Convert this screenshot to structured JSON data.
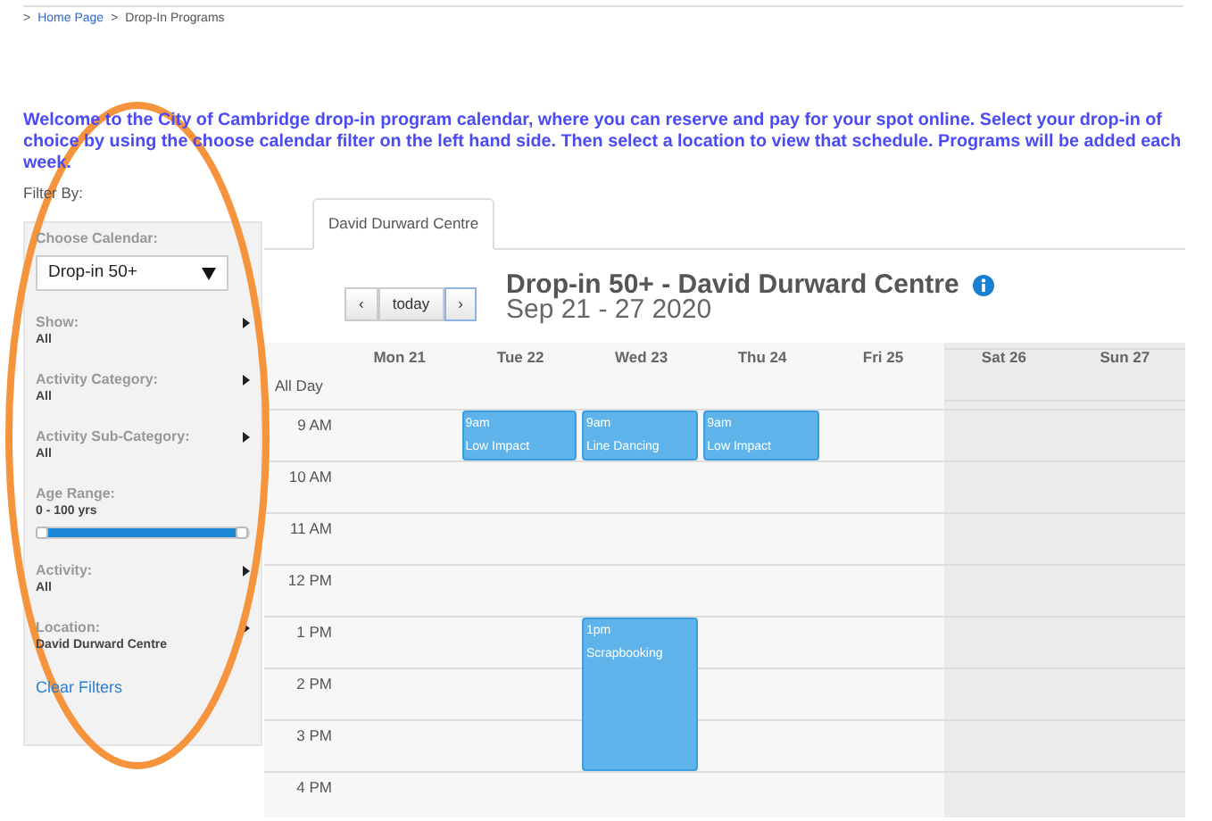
{
  "breadcrumb": {
    "separator": ">",
    "items": [
      {
        "label": "Home Page",
        "kind": "link"
      },
      {
        "label": "Drop-In Programs",
        "kind": "current"
      }
    ]
  },
  "intro": "Welcome to the City of Cambridge drop-in program calendar, where you can reserve and pay for your spot online. Select your drop-in of choice by using the choose calendar filter on the left hand side. Then select a location to view that schedule. Programs will be added each week.",
  "filter_heading": "Filter By:",
  "filters": [
    {
      "kind": "select",
      "label": "Choose Calendar:",
      "value": "Drop-in 50+"
    },
    {
      "kind": "menu",
      "label": "Show:",
      "value": "All"
    },
    {
      "kind": "menu",
      "label": "Activity Category:",
      "value": "All"
    },
    {
      "kind": "menu",
      "label": "Activity Sub-Category:",
      "value": "All"
    },
    {
      "kind": "range",
      "label": "Age Range:",
      "value": "0 - 100 yrs",
      "level": 1
    },
    {
      "kind": "menu",
      "label": "Activity:",
      "value": "All"
    },
    {
      "kind": "menu",
      "label": "Location:",
      "value": "David Durward Centre"
    }
  ],
  "clear_filters": "Clear Filters",
  "tabs": [
    {
      "label": "David Durward Centre",
      "selected": true
    }
  ],
  "nav_buttons": [
    {
      "label": "‹",
      "focused": false
    },
    {
      "label": "today",
      "focused": false
    },
    {
      "label": "›",
      "focused": true
    }
  ],
  "calendar_title": "Drop-in 50+ - David Durward Centre",
  "date_range": "Sep 21 - 27 2020",
  "days": [
    {
      "label": "Mon 21",
      "weekend": false
    },
    {
      "label": "Tue 22",
      "weekend": false,
      "slots": [
        {
          "kind": "short",
          "time": "9am",
          "title": "Low Impact"
        }
      ]
    },
    {
      "label": "Wed 23",
      "weekend": false,
      "slots": [
        {
          "kind": "short",
          "time": "9am",
          "title": "Line Dancing"
        },
        {
          "kind": "gap"
        },
        {
          "kind": "gap"
        },
        {
          "kind": "gap"
        },
        {
          "kind": "long",
          "time": "1pm",
          "title": "Scrapbooking"
        }
      ]
    },
    {
      "label": "Thu 24",
      "weekend": false,
      "slots": [
        {
          "kind": "short",
          "time": "9am",
          "title": "Low Impact"
        }
      ]
    },
    {
      "label": "Fri 25",
      "weekend": false
    },
    {
      "label": "Sat 26",
      "weekend": true
    },
    {
      "label": "Sun 27",
      "weekend": true
    }
  ],
  "all_day_label": "All Day",
  "hours": [
    "9 AM",
    "10 AM",
    "11 AM",
    "12 PM",
    "1 PM",
    "2 PM",
    "3 PM",
    "4 PM"
  ]
}
